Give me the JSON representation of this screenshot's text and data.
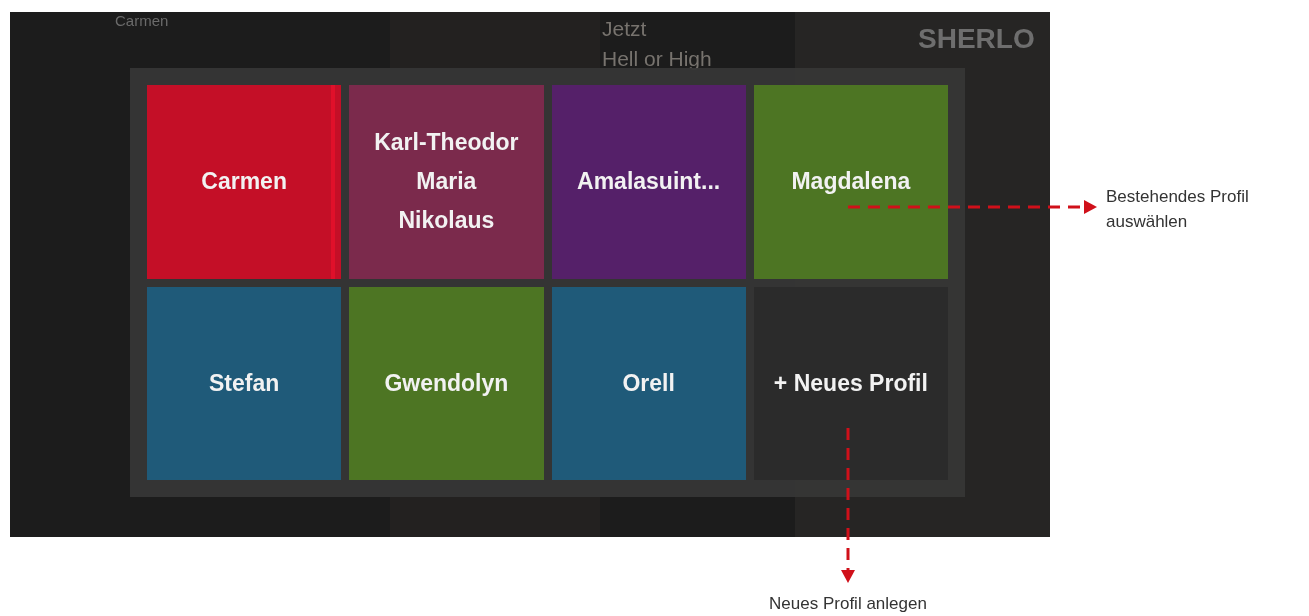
{
  "background": {
    "header_name": "Carmen",
    "teaser_lines": [
      "Jetzt",
      "Hell or High"
    ],
    "show_title": "SHERLO"
  },
  "profiles": [
    {
      "kind": "profile",
      "label": "Carmen",
      "color": "#c40f27",
      "selected": true
    },
    {
      "kind": "profile",
      "label": "Karl-Theodor Maria Nikolaus",
      "color": "#7b2a4c",
      "selected": false
    },
    {
      "kind": "profile",
      "label": "Amalasuint...",
      "color": "#552069",
      "selected": false
    },
    {
      "kind": "profile",
      "label": "Magdalena",
      "color": "#4d7523",
      "selected": false
    },
    {
      "kind": "profile",
      "label": "Stefan",
      "color": "#1f5a79",
      "selected": false
    },
    {
      "kind": "profile",
      "label": "Gwendolyn",
      "color": "#4d7523",
      "selected": false
    },
    {
      "kind": "profile",
      "label": "Orell",
      "color": "#1f5a79",
      "selected": false
    },
    {
      "kind": "add",
      "label": "+ Neues Profil",
      "selected": false
    }
  ],
  "annotations": [
    {
      "text": "Bestehendes Profil auswählen"
    },
    {
      "text": "Neues Profil anlegen"
    }
  ]
}
